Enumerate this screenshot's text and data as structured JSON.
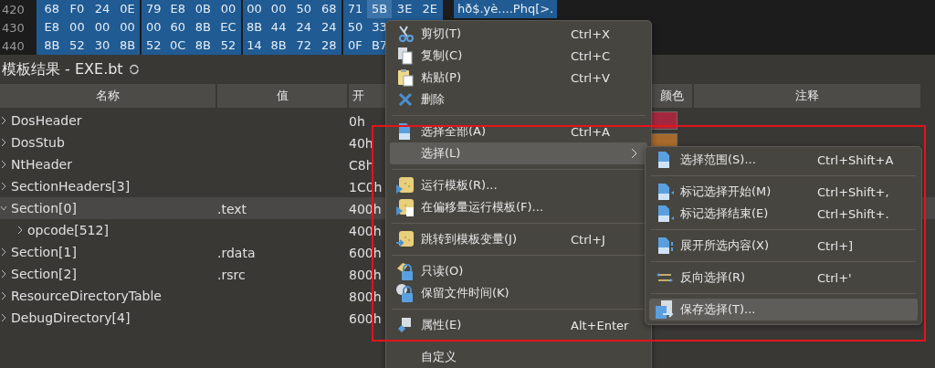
{
  "hex_view": {
    "rows": [
      {
        "address": "420",
        "bytes": [
          {
            "text": "68",
            "selected": false
          },
          {
            "text": "F0",
            "selected": false
          },
          {
            "text": "24",
            "selected": false
          },
          {
            "text": "0E",
            "selected": false
          },
          {
            "text": "79",
            "selected": false
          },
          {
            "text": "E8",
            "selected": false
          },
          {
            "text": "0B",
            "selected": false
          },
          {
            "text": "00",
            "selected": false
          },
          {
            "text": "00",
            "selected": false
          },
          {
            "text": "00",
            "selected": false
          },
          {
            "text": "50",
            "selected": false
          },
          {
            "text": "68",
            "selected": false
          },
          {
            "text": "71",
            "selected": false
          },
          {
            "text": "5B",
            "selected": true
          },
          {
            "text": "3E",
            "selected": false
          },
          {
            "text": "2E",
            "selected": false
          }
        ],
        "text": "hð$.yè....Phq[>."
      },
      {
        "address": "430",
        "bytes": [
          {
            "text": "E8",
            "selected": false
          },
          {
            "text": "00",
            "selected": false
          },
          {
            "text": "00",
            "selected": false
          },
          {
            "text": "00",
            "selected": false
          },
          {
            "text": "00",
            "selected": false
          },
          {
            "text": "60",
            "selected": false
          },
          {
            "text": "8B",
            "selected": false
          },
          {
            "text": "EC",
            "selected": false
          },
          {
            "text": "8B",
            "selected": false
          },
          {
            "text": "44",
            "selected": false
          },
          {
            "text": "24",
            "selected": false
          },
          {
            "text": "24",
            "selected": false
          },
          {
            "text": "50",
            "selected": false
          },
          {
            "text": "33",
            "selected": false
          }
        ]
      },
      {
        "address": "440",
        "bytes": [
          {
            "text": "8B",
            "selected": false
          },
          {
            "text": "52",
            "selected": false
          },
          {
            "text": "30",
            "selected": false
          },
          {
            "text": "8B",
            "selected": false
          },
          {
            "text": "52",
            "selected": false
          },
          {
            "text": "0C",
            "selected": false
          },
          {
            "text": "8B",
            "selected": false
          },
          {
            "text": "52",
            "selected": false
          },
          {
            "text": "14",
            "selected": false
          },
          {
            "text": "8B",
            "selected": false
          },
          {
            "text": "72",
            "selected": false
          },
          {
            "text": "28",
            "selected": false
          },
          {
            "text": "0F",
            "selected": false
          },
          {
            "text": "B7",
            "selected": false
          }
        ]
      }
    ]
  },
  "template_results": {
    "title": "模板结果 - EXE.bt",
    "columns": [
      "名称",
      "值",
      "开",
      "颜色",
      "注释"
    ],
    "rows": [
      {
        "name": "DosHeader",
        "start": "0h",
        "expanded": false,
        "selected": false,
        "color": "#a3283f"
      },
      {
        "name": "DosStub",
        "start": "40h",
        "expanded": false,
        "selected": false,
        "color": "#a86a2c"
      },
      {
        "name": "NtHeader",
        "start": "C8h",
        "expanded": false,
        "selected": false
      },
      {
        "name": "SectionHeaders[3]",
        "start": "1C0h",
        "expanded": false,
        "selected": false
      },
      {
        "name": "Section[0]",
        "value": ".text",
        "start": "400h",
        "expanded": true,
        "selected": true,
        "children": [
          {
            "name": "opcode[512]",
            "start": "400h",
            "expanded": false,
            "selected": false
          }
        ]
      },
      {
        "name": "Section[1]",
        "value": ".rdata",
        "start": "600h",
        "expanded": false,
        "selected": false
      },
      {
        "name": "Section[2]",
        "value": ".rsrc",
        "start": "800h",
        "expanded": false,
        "selected": false
      },
      {
        "name": "ResourceDirectoryTable",
        "start": "800h",
        "expanded": false,
        "selected": false
      },
      {
        "name": "DebugDirectory[4]",
        "start": "600h",
        "expanded": false,
        "selected": false
      }
    ]
  },
  "context_menu": {
    "items": [
      {
        "kind": "item",
        "label": "剪切(T)",
        "shortcut": "Ctrl+X",
        "selected": false
      },
      {
        "kind": "item",
        "label": "复制(C)",
        "shortcut": "Ctrl+C",
        "selected": false
      },
      {
        "kind": "item",
        "label": "粘贴(P)",
        "shortcut": "Ctrl+V",
        "selected": false
      },
      {
        "kind": "item",
        "label": "删除",
        "selected": false
      },
      {
        "kind": "separator"
      },
      {
        "kind": "item",
        "label": "选择全部(A)",
        "shortcut": "Ctrl+A",
        "selected": false
      },
      {
        "kind": "submenu",
        "label": "选择(L)",
        "selected": true
      },
      {
        "kind": "separator"
      },
      {
        "kind": "item",
        "label": "运行模板(R)...",
        "selected": false
      },
      {
        "kind": "item",
        "label": "在偏移量运行模板(F)...",
        "selected": false
      },
      {
        "kind": "separator"
      },
      {
        "kind": "item",
        "label": "跳转到模板变量(J)",
        "shortcut": "Ctrl+J",
        "selected": false
      },
      {
        "kind": "separator"
      },
      {
        "kind": "item",
        "label": "只读(O)",
        "selected": false
      },
      {
        "kind": "item",
        "label": "保留文件时间(K)",
        "selected": false
      },
      {
        "kind": "separator"
      },
      {
        "kind": "item",
        "label": "属性(E)",
        "shortcut": "Alt+Enter",
        "selected": false
      },
      {
        "kind": "separator"
      },
      {
        "kind": "item",
        "label": "自定义",
        "selected": false
      }
    ]
  },
  "submenu": {
    "items": [
      {
        "kind": "item",
        "label": "选择范围(S)...",
        "shortcut": "Ctrl+Shift+A",
        "selected": false
      },
      {
        "kind": "separator"
      },
      {
        "kind": "item",
        "label": "标记选择开始(M)",
        "shortcut": "Ctrl+Shift+,",
        "selected": false
      },
      {
        "kind": "item",
        "label": "标记选择结束(E)",
        "shortcut": "Ctrl+Shift+.",
        "selected": false
      },
      {
        "kind": "separator"
      },
      {
        "kind": "item",
        "label": "展开所选内容(X)",
        "shortcut": "Ctrl+]",
        "selected": false
      },
      {
        "kind": "separator"
      },
      {
        "kind": "item",
        "label": "反向选择(R)",
        "shortcut": "Ctrl+'",
        "selected": false
      },
      {
        "kind": "separator"
      },
      {
        "kind": "item",
        "label": "保存选择(T)...",
        "selected": true
      }
    ]
  }
}
